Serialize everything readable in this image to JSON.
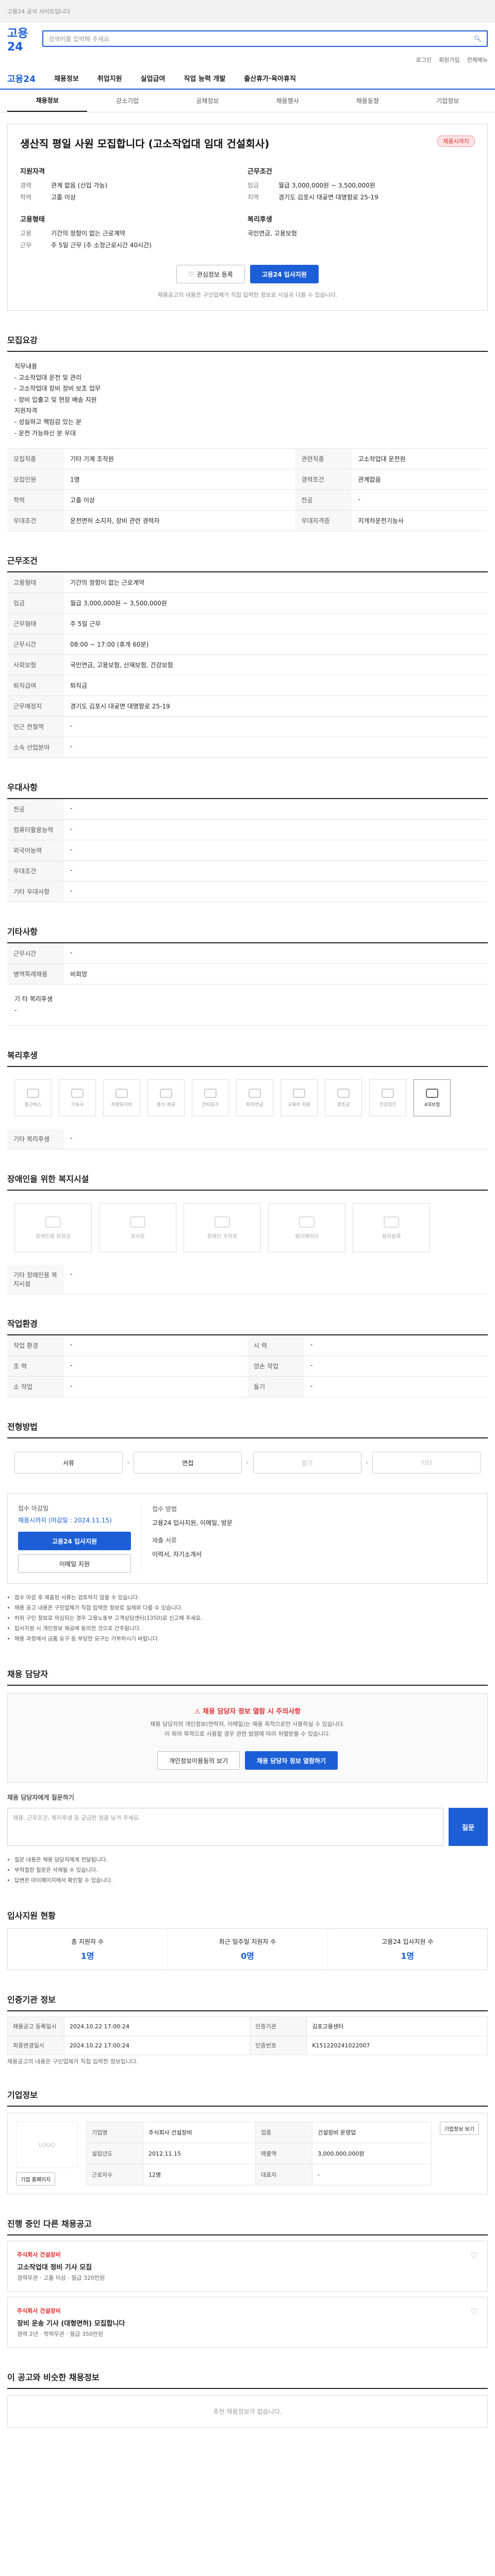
{
  "top": {
    "notice": "고용24 공식 사이트입니다"
  },
  "header": {
    "logo": "고용24",
    "search_placeholder": "검색어를 입력해 주세요"
  },
  "util": [
    "로그인",
    "회원가입",
    "전체메뉴"
  ],
  "gnb": [
    "채용정보",
    "취업지원",
    "실업급여",
    "직업 능력 개발",
    "출산휴가·육아휴직"
  ],
  "tabs": [
    "채용정보",
    "강소기업",
    "공채정보",
    "채용행사",
    "채용동향",
    "기업정보"
  ],
  "job": {
    "status": "채용시까지",
    "title": "생산직 평일 사원 모집합니다 (고소작업대 임대 건설회사)",
    "company_h": "지원자격",
    "company": [
      {
        "k": "경력",
        "v": "관계 없음 (신입 가능)"
      },
      {
        "k": "학력",
        "v": "고졸 이상"
      }
    ],
    "cond_h": "근무조건",
    "cond": [
      {
        "k": "임금",
        "v": "월급 3,000,000원 ~ 3,500,000원"
      },
      {
        "k": "지역",
        "v": "경기도 김포시 대곶면 대명항로 25-19"
      }
    ],
    "form_h": "고용형태",
    "form": [
      {
        "k": "고용",
        "v": "기간의 정함이 없는 근로계약"
      },
      {
        "k": "근무",
        "v": "주 5일 근무 (주 소정근로시간 40시간)"
      }
    ],
    "benefit_h": "복리후생",
    "benefit": [
      {
        "k": "",
        "v": "국민연금, 고용보험"
      }
    ],
    "btn_save": "관심정보 등록",
    "btn_apply": "고용24 입사지원",
    "note": "채용공고의 내용은 구인업체가 직접 입력한 정보로 사실과 다를 수 있습니다."
  },
  "sec_recruit": {
    "title": "모집요강",
    "desc": "직무내용\n- 고소작업대 운전 및 관리\n- 고소작업대 장비 정비 보조 업무\n- 장비 입출고 및 현장 배송 지원\n지원자격\n- 성실하고 책임감 있는 분\n- 운전 가능하신 분 우대",
    "rows": [
      {
        "k": "모집직종",
        "v": "기타 기계 조작원"
      },
      {
        "k": "관련직종",
        "v": "고소작업대 운전원"
      },
      {
        "k": "모집인원",
        "v": "1명"
      },
      {
        "k": "경력조건",
        "v": "관계없음"
      },
      {
        "k": "학력",
        "v": "고졸 이상"
      },
      {
        "k": "전공",
        "v": "-"
      },
      {
        "k": "우대조건",
        "v": "운전면허 소지자, 장비 관련 경력자"
      },
      {
        "k": "우대자격증",
        "v": "지게차운전기능사"
      }
    ]
  },
  "sec_cond": {
    "title": "근무조건",
    "rows": [
      {
        "k": "고용형태",
        "v": "기간의 정함이 없는 근로계약"
      },
      {
        "k": "임금",
        "v": "월급 3,000,000원 ~ 3,500,000원"
      },
      {
        "k": "근무형태",
        "v": "주 5일 근무"
      },
      {
        "k": "근무시간",
        "v": "08:00 ~ 17:00 (휴게 60분)"
      },
      {
        "k": "사회보험",
        "v": "국민연금, 고용보험, 산재보험, 건강보험"
      },
      {
        "k": "퇴직급여",
        "v": "퇴직금"
      },
      {
        "k": "근무예정지",
        "v": "경기도 김포시 대곶면 대명항로 25-19"
      },
      {
        "k": "인근 전철역",
        "v": "-"
      },
      {
        "k": "소속 산업분야",
        "v": "-"
      }
    ]
  },
  "sec_prefer": {
    "title": "우대사항",
    "rows": [
      {
        "k": "전공",
        "v": "-"
      },
      {
        "k": "컴퓨터활용능력",
        "v": "-"
      },
      {
        "k": "외국어능력",
        "v": "-"
      },
      {
        "k": "우대조건",
        "v": "-"
      },
      {
        "k": "기타 우대사항",
        "v": "-"
      }
    ]
  },
  "sec_etc": {
    "title": "기타사항",
    "rows": [
      {
        "k": "근무시간",
        "v": "-"
      },
      {
        "k": "병역특례채용",
        "v": "비희망"
      }
    ],
    "desc": "기 타 복리후생\n-"
  },
  "sec_welfare": {
    "title": "복리후생",
    "items": [
      {
        "label": "통근버스",
        "on": false
      },
      {
        "label": "기숙사",
        "on": false
      },
      {
        "label": "차량유지비",
        "on": false
      },
      {
        "label": "중식 제공",
        "on": false
      },
      {
        "label": "연차휴가",
        "on": false
      },
      {
        "label": "퇴직연금",
        "on": false
      },
      {
        "label": "교육비 지원",
        "on": false
      },
      {
        "label": "경조금",
        "on": false
      },
      {
        "label": "건강검진",
        "on": false
      },
      {
        "label": "4대보험",
        "on": true
      }
    ],
    "etc_label": "기타 복리후생",
    "etc_value": "-"
  },
  "sec_disab": {
    "title": "장애인을 위한 복지시설",
    "items": [
      "장애인용 화장실",
      "경사로",
      "장애인 주차장",
      "엘리베이터",
      "점자블록"
    ],
    "etc_label": "기타 장애인용 복지시설",
    "etc_value": "-"
  },
  "sec_work": {
    "title": "작업환경",
    "rows": [
      {
        "k": "작업 환경",
        "v": "-"
      },
      {
        "k": "시 력",
        "v": "-"
      },
      {
        "k": "조 력",
        "v": "-"
      },
      {
        "k": "양손 작업",
        "v": "-"
      },
      {
        "k": "소 작업",
        "v": "-"
      },
      {
        "k": "들기",
        "v": "-"
      }
    ]
  },
  "sec_process": {
    "title": "전형방법",
    "steps": [
      {
        "label": "서류",
        "on": true
      },
      {
        "label": "면접",
        "on": true
      },
      {
        "label": "필기",
        "on": false
      },
      {
        "label": "기타",
        "on": false
      }
    ],
    "deadline_label": "접수 마감일",
    "deadline": "채용시까지 (마감일 : 2024.11.15)",
    "method_label": "접수 방법",
    "method": "고용24 입사지원, 이메일, 방문",
    "doc_label": "제출 서류",
    "doc": "이력서, 자기소개서",
    "btn_apply": "고용24 입사지원",
    "btn_mail": "이메일 지원",
    "bullets": [
      "접수 마감 후 제출된 서류는 검토하지 않을 수 있습니다.",
      "채용 공고 내용은 구인업체가 직접 입력한 정보로 실제와 다를 수 있습니다.",
      "허위 구인 정보로 의심되는 경우 고용노동부 고객상담센터(1350)로 신고해 주세요.",
      "입사지원 시 개인정보 제공에 동의한 것으로 간주됩니다.",
      "채용 과정에서 금품 요구 등 부당한 요구는 거부하시기 바랍니다."
    ]
  },
  "sec_contact": {
    "title": "채용 담당자",
    "alert_title": "채용 담당자 정보 열람 시 주의사항",
    "alert_text": "채용 담당자의 개인정보(연락처, 이메일)는 채용 목적으로만 사용하실 수 있습니다.\n이 외의 목적으로 사용할 경우 관련 법령에 따라 처벌받을 수 있습니다.",
    "btn_agree": "개인정보이용동의 보기",
    "btn_view": "채용 담당자 정보 열람하기",
    "qna_label": "채용 담당자에게 질문하기",
    "qna_placeholder": "채용, 근무조건, 복리후생 등 궁금한 점을 남겨 주세요.",
    "qna_send": "질문",
    "notes": [
      "질문 내용은 채용 담당자에게 전달됩니다.",
      "부적절한 질문은 삭제될 수 있습니다.",
      "답변은 마이페이지에서 확인할 수 있습니다."
    ]
  },
  "sec_stats": {
    "title": "입사지원 현황",
    "items": [
      {
        "label": "총 지원자 수",
        "value": "1명"
      },
      {
        "label": "최근 일주일 지원자 수",
        "value": "0명"
      },
      {
        "label": "고용24 입사지원 수",
        "value": "1명"
      }
    ]
  },
  "sec_info": {
    "title": "인증기관 정보",
    "rows": [
      {
        "k": "채용공고 등록일시",
        "v": "2024.10.22 17:00:24"
      },
      {
        "k": "인증기관",
        "v": "김포고용센터"
      },
      {
        "k": "최종변경일시",
        "v": "2024.10.22 17:00:24"
      },
      {
        "k": "인증번호",
        "v": "K151220241022007"
      }
    ],
    "note": "채용공고의 내용은 구인업체가 직접 입력한 정보입니다."
  },
  "sec_company": {
    "title": "기업정보",
    "logo": "LOGO",
    "rows": [
      {
        "k": "기업명",
        "v": "주식회사 건설장비"
      },
      {
        "k": "업종",
        "v": "건설장비 운영업"
      },
      {
        "k": "설립년도",
        "v": "2012.11.15"
      },
      {
        "k": "매출액",
        "v": "3,000,000,000원"
      },
      {
        "k": "근로자수",
        "v": "12명"
      },
      {
        "k": "대표자",
        "v": "-"
      }
    ],
    "btn_home": "기업 홈페이지",
    "btn_info": "기업정보 보기"
  },
  "sec_other": {
    "title": "진행 중인 다른 채용공고",
    "jobs": [
      {
        "company": "주식회사 건설장비",
        "title": "고소작업대 정비 기사 모집",
        "meta": "경력무관 · 고졸 이상 · 월급 320만원"
      },
      {
        "company": "주식회사 건설장비",
        "title": "장비 운송 기사 (대형면허) 모집합니다",
        "meta": "경력 2년 · 학력무관 · 월급 350만원"
      }
    ]
  },
  "sec_recommend": {
    "title": "이 공고와 비슷한 채용정보",
    "empty": "추천 채용정보가 없습니다."
  }
}
